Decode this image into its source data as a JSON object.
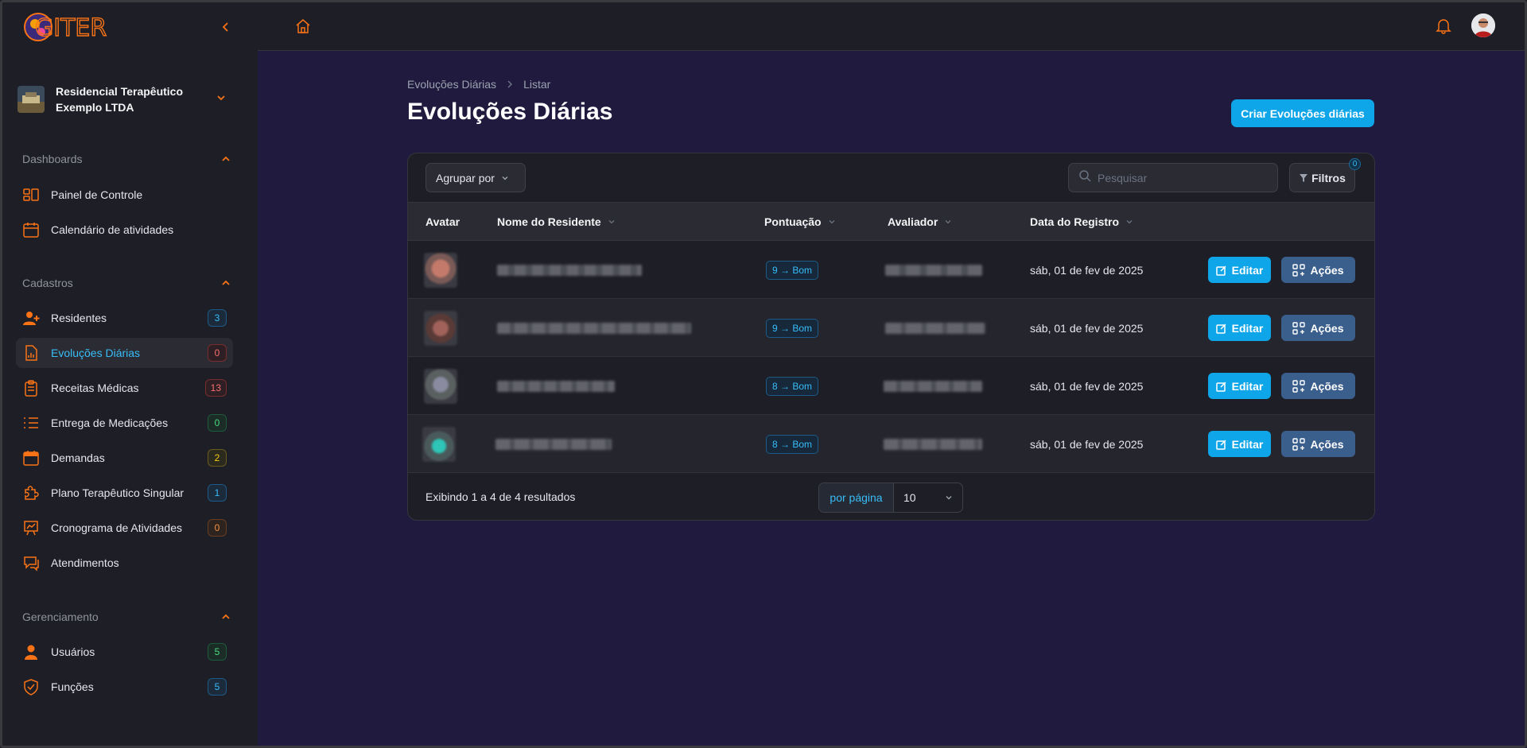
{
  "brand": {
    "logo_text": "GITER",
    "accent": "#f97316",
    "primary": "#0ea5e9"
  },
  "tenant": {
    "name": "Residencial Terapêutico Exemplo LTDA"
  },
  "sidebar": {
    "groups": [
      {
        "title": "Dashboards",
        "items": [
          {
            "label": "Painel de Controle",
            "icon": "dashboard-icon"
          },
          {
            "label": "Calendário de atividades",
            "icon": "calendar-icon"
          }
        ]
      },
      {
        "title": "Cadastros",
        "items": [
          {
            "label": "Residentes",
            "icon": "user-plus-icon",
            "badge": "3"
          },
          {
            "label": "Evoluções Diárias",
            "icon": "document-chart-icon",
            "badge": "0",
            "active": true
          },
          {
            "label": "Receitas Médicas",
            "icon": "clipboard-icon",
            "badge": "13"
          },
          {
            "label": "Entrega de Medicações",
            "icon": "list-icon",
            "badge": "0"
          },
          {
            "label": "Demandas",
            "icon": "calendar-days-icon",
            "badge": "2"
          },
          {
            "label": "Plano Terapêutico Singular",
            "icon": "puzzle-icon",
            "badge": "1"
          },
          {
            "label": "Cronograma de Atividades",
            "icon": "presentation-chart-icon",
            "badge": "0"
          },
          {
            "label": "Atendimentos",
            "icon": "chat-icon"
          }
        ]
      },
      {
        "title": "Gerenciamento",
        "items": [
          {
            "label": "Usuários",
            "icon": "user-icon",
            "badge": "5"
          },
          {
            "label": "Funções",
            "icon": "shield-icon",
            "badge": "5"
          }
        ]
      }
    ]
  },
  "breadcrumb": {
    "parent": "Evoluções Diárias",
    "current": "Listar"
  },
  "page": {
    "title": "Evoluções Diárias",
    "create_label": "Criar Evoluções diárias"
  },
  "toolbar": {
    "group_by": "Agrupar por",
    "search_placeholder": "Pesquisar",
    "filters_label": "Filtros",
    "filters_count": "0"
  },
  "table": {
    "columns": [
      "Avatar",
      "Nome do Residente",
      "Pontuação",
      "Avaliador",
      "Data do Registro"
    ],
    "rows": [
      {
        "score": "9 → Bom",
        "date": "sáb, 01 de fev de 2025"
      },
      {
        "score": "9 → Bom",
        "date": "sáb, 01 de fev de 2025"
      },
      {
        "score": "8 → Bom",
        "date": "sáb, 01 de fev de 2025"
      },
      {
        "score": "8 → Bom",
        "date": "sáb, 01 de fev de 2025"
      }
    ],
    "edit_label": "Editar",
    "actions_label": "Ações"
  },
  "pagination": {
    "summary": "Exibindo 1 a 4 de 4 resultados",
    "per_page_label": "por página",
    "per_page_value": "10"
  }
}
